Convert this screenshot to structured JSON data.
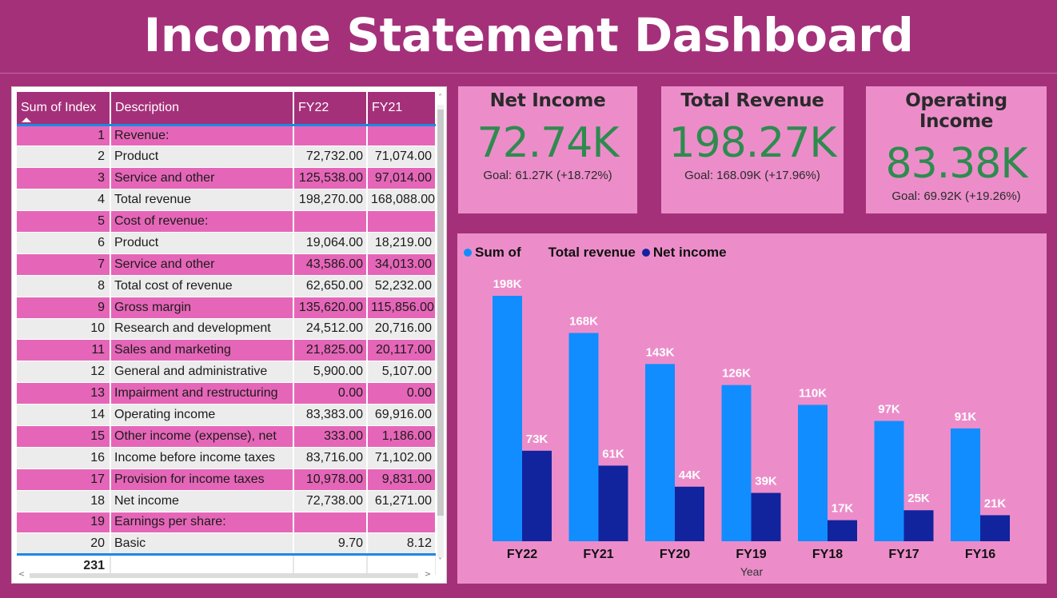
{
  "title": "Income Statement Dashboard",
  "table": {
    "columns": [
      "Sum of Index",
      "Description",
      "FY22",
      "FY21"
    ],
    "rows": [
      {
        "index": "1",
        "description": "Revenue:",
        "fy22": "",
        "fy21": ""
      },
      {
        "index": "2",
        "description": "Product",
        "fy22": "72,732.00",
        "fy21": "71,074.00"
      },
      {
        "index": "3",
        "description": "Service and other",
        "fy22": "125,538.00",
        "fy21": "97,014.00"
      },
      {
        "index": "4",
        "description": "Total revenue",
        "fy22": "198,270.00",
        "fy21": "168,088.00"
      },
      {
        "index": "5",
        "description": "Cost of revenue:",
        "fy22": "",
        "fy21": ""
      },
      {
        "index": "6",
        "description": "Product",
        "fy22": "19,064.00",
        "fy21": "18,219.00"
      },
      {
        "index": "7",
        "description": "Service and other",
        "fy22": "43,586.00",
        "fy21": "34,013.00"
      },
      {
        "index": "8",
        "description": "Total cost of revenue",
        "fy22": "62,650.00",
        "fy21": "52,232.00"
      },
      {
        "index": "9",
        "description": "Gross margin",
        "fy22": "135,620.00",
        "fy21": "115,856.00"
      },
      {
        "index": "10",
        "description": "Research and development",
        "fy22": "24,512.00",
        "fy21": "20,716.00"
      },
      {
        "index": "11",
        "description": "Sales and marketing",
        "fy22": "21,825.00",
        "fy21": "20,117.00"
      },
      {
        "index": "12",
        "description": "General and administrative",
        "fy22": "5,900.00",
        "fy21": "5,107.00"
      },
      {
        "index": "13",
        "description": "Impairment and restructuring",
        "fy22": "0.00",
        "fy21": "0.00"
      },
      {
        "index": "14",
        "description": "Operating income",
        "fy22": "83,383.00",
        "fy21": "69,916.00"
      },
      {
        "index": "15",
        "description": "Other income (expense), net",
        "fy22": "333.00",
        "fy21": "1,186.00"
      },
      {
        "index": "16",
        "description": "Income before income taxes",
        "fy22": "83,716.00",
        "fy21": "71,102.00"
      },
      {
        "index": "17",
        "description": "Provision for income taxes",
        "fy22": "10,978.00",
        "fy21": "9,831.00"
      },
      {
        "index": "18",
        "description": "Net income",
        "fy22": "72,738.00",
        "fy21": "61,271.00"
      },
      {
        "index": "19",
        "description": "Earnings per share:",
        "fy22": "",
        "fy21": ""
      },
      {
        "index": "20",
        "description": "Basic",
        "fy22": "9.70",
        "fy21": "8.12"
      }
    ],
    "total": "231"
  },
  "kpis": [
    {
      "title": "Net Income",
      "value": "72.74K",
      "goal": "Goal: 61.27K (+18.72%)"
    },
    {
      "title": "Total Revenue",
      "value": "198.27K",
      "goal": "Goal: 168.09K (+17.96%)"
    },
    {
      "title": "Operating Income",
      "value": "83.38K",
      "goal": "Goal: 69.92K (+19.26%)"
    }
  ],
  "legend": {
    "label_1": "Sum of",
    "label_2": "Total revenue",
    "label_3": "Net income"
  },
  "colors": {
    "background": "#A4307A",
    "revenue_bar": "#118DFF",
    "net_income_bar": "#12239E",
    "kpi_value": "#2E8B4E"
  },
  "chart_data": {
    "type": "bar",
    "categories": [
      "FY22",
      "FY21",
      "FY20",
      "FY19",
      "FY18",
      "FY17",
      "FY16"
    ],
    "series": [
      {
        "name": "Total revenue",
        "values": [
          198,
          168,
          143,
          126,
          110,
          97,
          91
        ],
        "labels": [
          "198K",
          "168K",
          "143K",
          "126K",
          "110K",
          "97K",
          "91K"
        ]
      },
      {
        "name": "Net income",
        "values": [
          73,
          61,
          44,
          39,
          17,
          25,
          21
        ],
        "labels": [
          "73K",
          "61K",
          "44K",
          "39K",
          "17K",
          "25K",
          "21K"
        ]
      }
    ],
    "xlabel": "Year",
    "ylabel": "",
    "ylim": [
      0,
      198
    ]
  }
}
